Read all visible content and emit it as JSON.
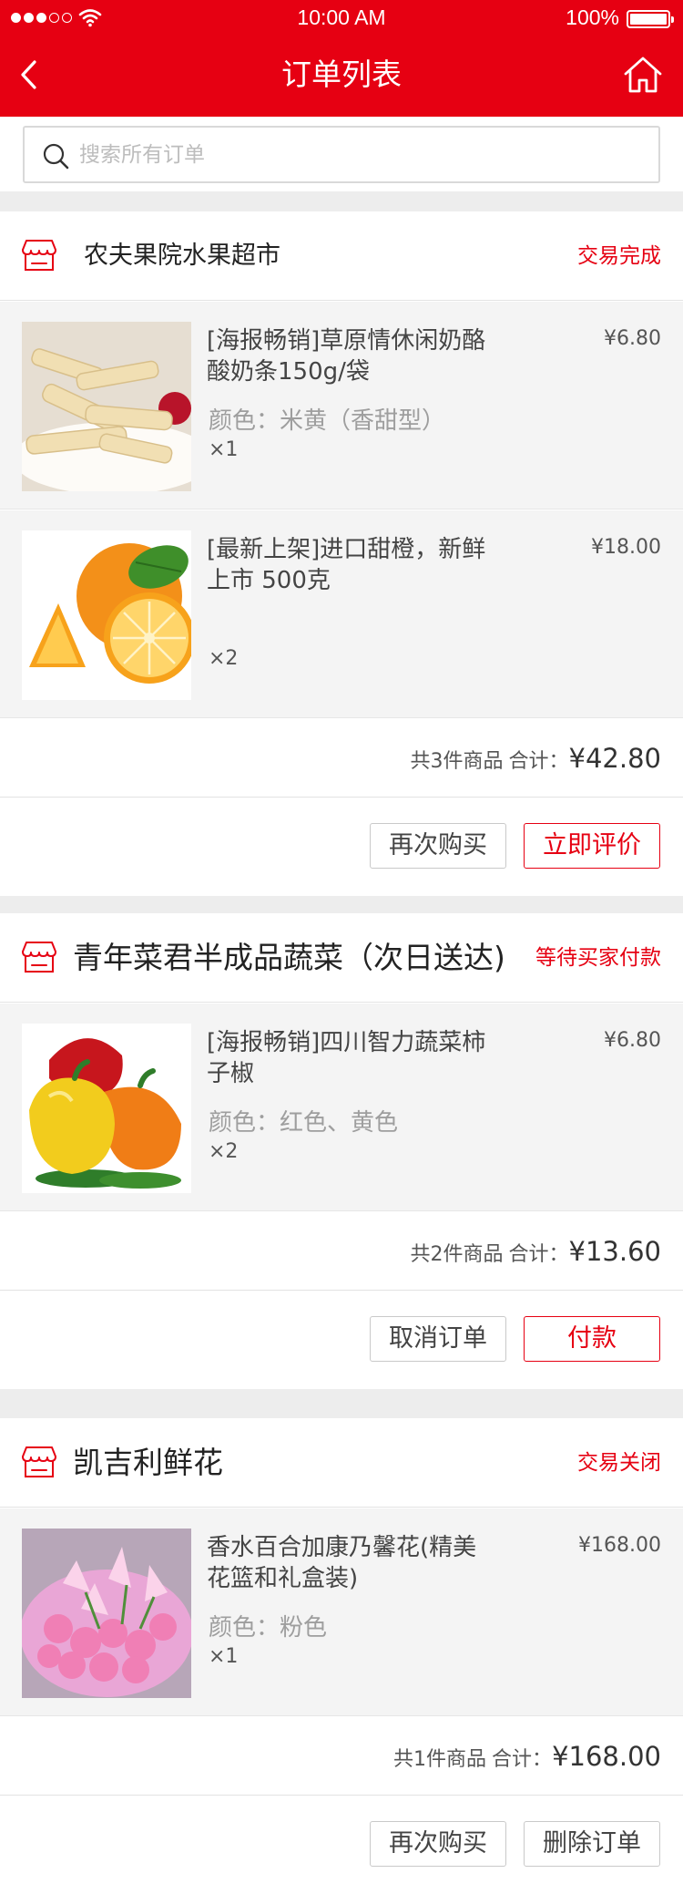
{
  "status_bar": {
    "time": "10:00 AM",
    "battery": "100%"
  },
  "nav": {
    "title": "订单列表"
  },
  "search": {
    "placeholder": "搜索所有订单"
  },
  "orders": [
    {
      "shop": "农夫果院水果超市",
      "status": "交易完成",
      "items": [
        {
          "name": "[海报畅销]草原情休闲奶酪酸奶条150g/袋",
          "spec": "颜色：米黄（香甜型）",
          "qty": "×1",
          "price": "¥6.80"
        },
        {
          "name": "[最新上架]进口甜橙，新鲜上市  500克",
          "spec": "",
          "qty": "×2",
          "price": "¥18.00"
        }
      ],
      "count_text": "共3件商品",
      "total_label": "合计：",
      "total": "¥42.80",
      "buttons": [
        "再次购买",
        "立即评价"
      ]
    },
    {
      "shop": "青年菜君半成品蔬菜（次日送达)",
      "status": "等待买家付款",
      "items": [
        {
          "name": "[海报畅销]四川智力蔬菜柿子椒",
          "spec": "颜色：红色、黄色",
          "qty": "×2",
          "price": "¥6.80"
        }
      ],
      "count_text": "共2件商品",
      "total_label": "合计：",
      "total": "¥13.60",
      "buttons": [
        "取消订单",
        "付款"
      ]
    },
    {
      "shop": "凯吉利鲜花",
      "status": "交易关闭",
      "items": [
        {
          "name": "香水百合加康乃馨花(精美花篮和礼盒装)",
          "spec": "颜色：粉色",
          "qty": "×1",
          "price": "¥168.00"
        }
      ],
      "count_text": "共1件商品",
      "total_label": "合计：",
      "total": "¥168.00",
      "buttons": [
        "再次购买",
        "删除订单"
      ]
    }
  ],
  "colors": {
    "accent": "#e60012",
    "background": "#ededed",
    "item_bg": "#f4f4f4"
  },
  "icons": [
    "back-arrow-icon",
    "home-icon",
    "search-icon",
    "shop-icon",
    "signal-icon",
    "wifi-icon",
    "battery-icon"
  ]
}
